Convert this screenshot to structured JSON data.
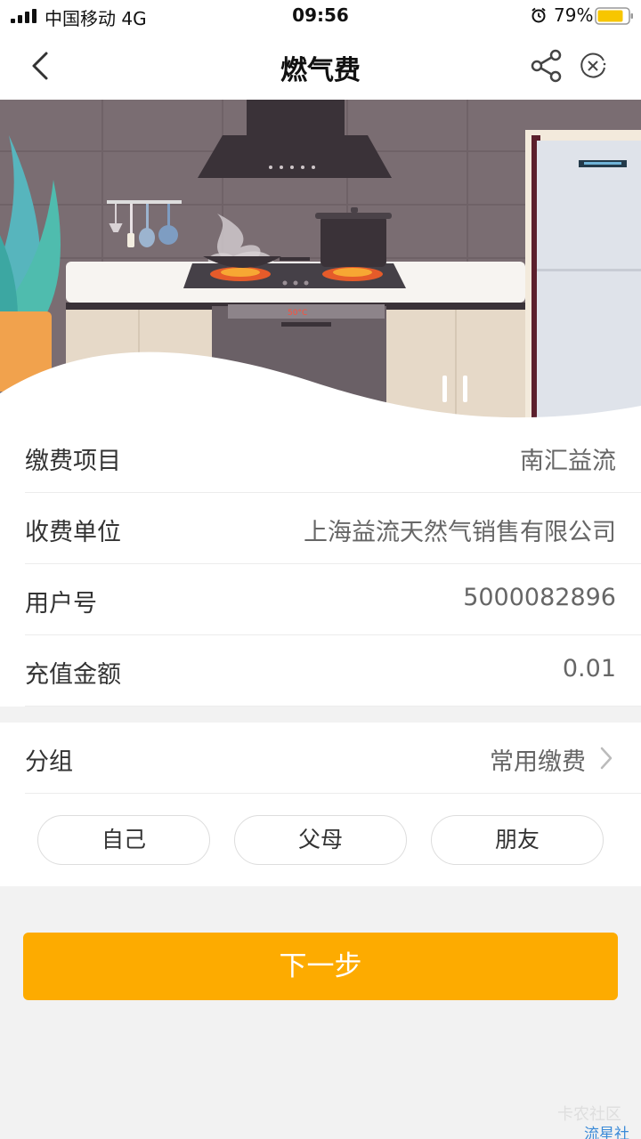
{
  "status_bar": {
    "carrier": "中国移动   4G",
    "time": "09:56",
    "battery": "79%"
  },
  "nav": {
    "title": "燃气费"
  },
  "banner": {
    "oven_display": "50°C"
  },
  "info_rows": [
    {
      "label": "缴费项目",
      "value": "南汇益流"
    },
    {
      "label": "收费单位",
      "value": "上海益流天然气销售有限公司"
    },
    {
      "label": "用户号",
      "value": "5000082896"
    },
    {
      "label": "充值金额",
      "value": "0.01"
    }
  ],
  "group": {
    "label": "分组",
    "value": "常用缴费",
    "chips": [
      "自己",
      "父母",
      "朋友"
    ]
  },
  "next_button": "下一步",
  "watermark": {
    "line1": "卡农社区",
    "line2": "流星社区"
  },
  "colors": {
    "accent": "#fdab00",
    "background": "#f2f2f2"
  }
}
